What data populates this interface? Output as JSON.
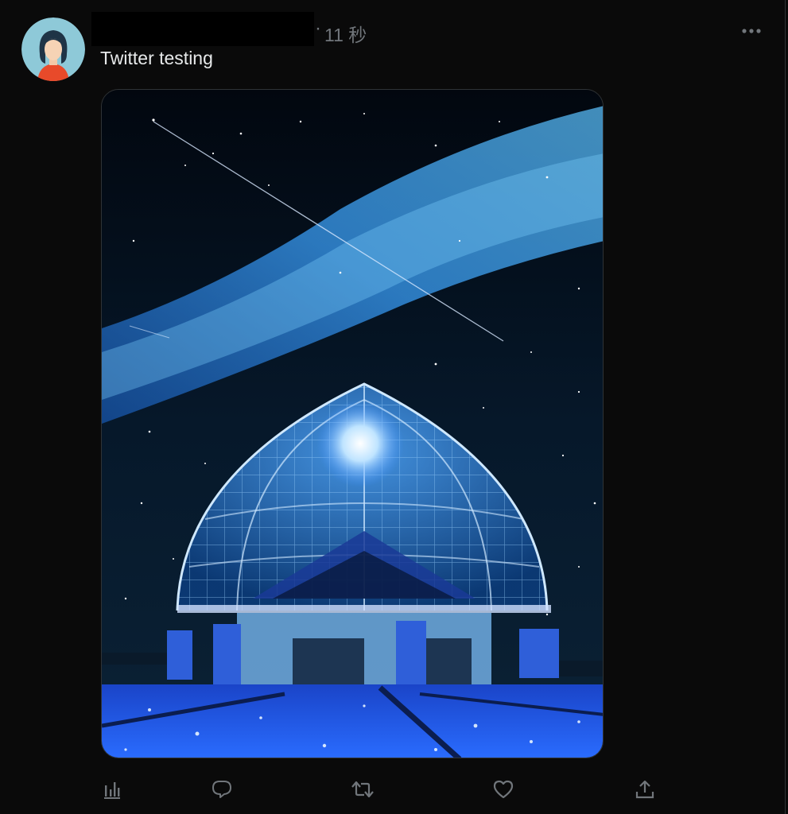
{
  "tweet": {
    "timestamp_separator": "·",
    "timestamp": "11 秒",
    "text": "Twitter testing"
  },
  "icons": {
    "more": "more-horizontal-icon",
    "views": "analytics-bar-icon",
    "reply": "reply-bubble-icon",
    "retweet": "retweet-arrows-icon",
    "like": "heart-icon",
    "share": "share-upload-icon"
  },
  "colors": {
    "background": "#0a0a0a",
    "text_primary": "#e7e9ea",
    "text_secondary": "#71767b",
    "avatar_bg": "#8ec9d8",
    "avatar_shirt": "#e84a2a",
    "image_accent": "#3a8cff"
  }
}
